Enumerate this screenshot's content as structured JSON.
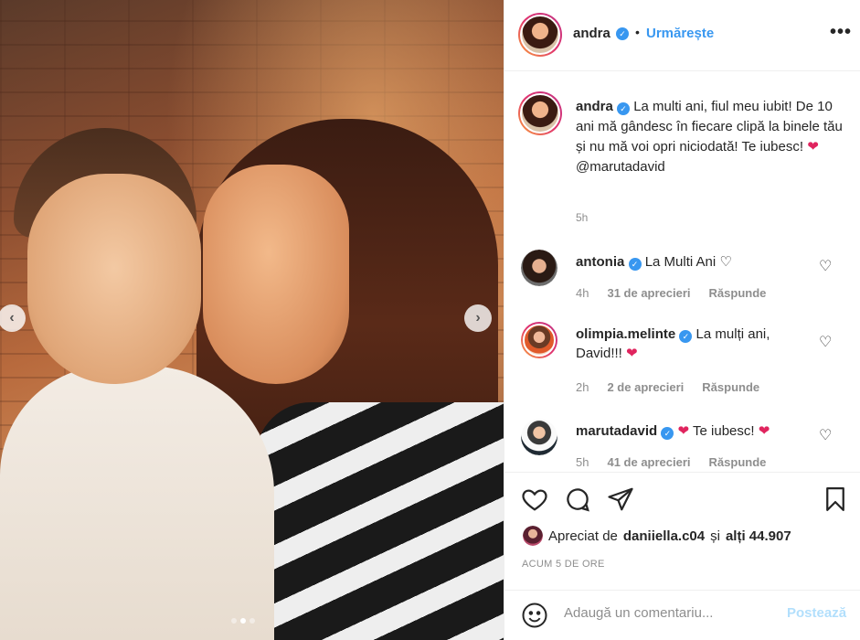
{
  "photo": {
    "prev_glyph": "‹",
    "next_glyph": "›",
    "carousel": {
      "total": 3,
      "active": 2
    }
  },
  "header": {
    "username": "andra",
    "bullet": "•",
    "follow_label": "Urmărește",
    "more_glyph": "•••",
    "verified_glyph": "✓"
  },
  "caption": {
    "username": "andra",
    "text": "La multi ani, fiul meu iubit! De 10 ani mă gândesc în fiecare clipă la binele tău și nu mă voi opri niciodată! Te iubesc!",
    "heart": "❤",
    "mention": "@marutadavid",
    "time": "5h"
  },
  "comments": [
    {
      "username": "antonia",
      "text": "La Multi Ani",
      "emoji": "♡",
      "time": "4h",
      "likes": "31 de aprecieri",
      "reply": "Răspunde"
    },
    {
      "username": "olimpia.melinte",
      "text": "La mulți ani, David!!!",
      "emoji": "❤",
      "time": "2h",
      "likes": "2 de aprecieri",
      "reply": "Răspunde"
    },
    {
      "username": "marutadavid",
      "text": "Te iubesc!",
      "emoji_before": "❤",
      "emoji": "❤",
      "time": "5h",
      "likes": "41 de aprecieri",
      "reply": "Răspunde"
    }
  ],
  "like_glyph": "♡",
  "actions": {
    "liked_prefix": "Apreciat de",
    "liked_user": "daniiella.c04",
    "liked_and": "și",
    "liked_others": "alți 44.907",
    "ago": "ACUM 5 DE ORE"
  },
  "add_comment": {
    "placeholder": "Adaugă un comentariu...",
    "post_label": "Postează"
  },
  "colors": {
    "accent": "#3897f0",
    "heart": "#e0245e",
    "muted": "#8e8e8e",
    "post_disabled": "#b2dffc"
  }
}
